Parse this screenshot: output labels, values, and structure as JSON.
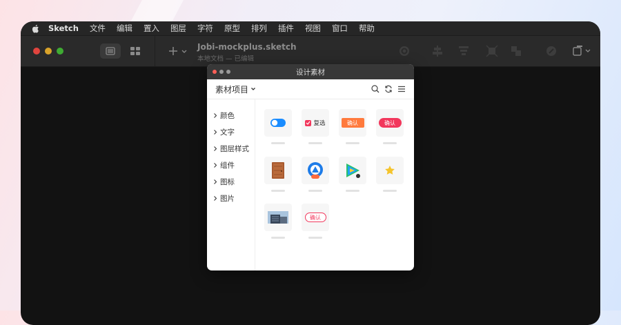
{
  "menubar": {
    "items": [
      "Sketch",
      "文件",
      "编辑",
      "置入",
      "图层",
      "字符",
      "原型",
      "排列",
      "插件",
      "视图",
      "窗口",
      "帮助"
    ]
  },
  "toolbar": {
    "doc_title": "Jobi-mockplus.sketch",
    "doc_subtitle": "本地文档 — 已编辑"
  },
  "panel": {
    "title": "设计素材",
    "project_label": "素材项目",
    "sidebar": [
      "颜色",
      "文字",
      "图层样式",
      "组件",
      "图标",
      "图片"
    ],
    "assets": {
      "checkbox_label": "复选",
      "confirm_orange": "确认",
      "confirm_pink": "确认",
      "confirm_outline": "确认"
    }
  },
  "colors": {
    "accent_pink": "#f2375c",
    "accent_orange": "#ff7a3d",
    "toggle_blue": "#1a8cff",
    "star_yellow": "#f5c42c"
  }
}
